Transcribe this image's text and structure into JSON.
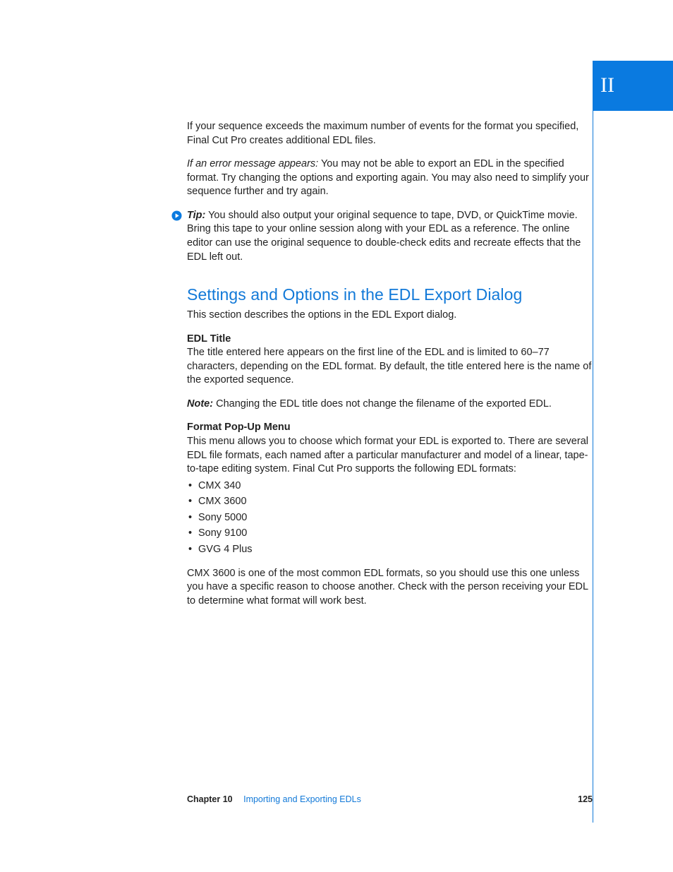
{
  "partTab": "II",
  "body": {
    "p1": "If your sequence exceeds the maximum number of events for the format you specified, Final Cut Pro creates additional EDL files.",
    "p2_lead": "If an error message appears:",
    "p2_rest": "  You may not be able to export an EDL in the specified format. Try changing the options and exporting again. You may also need to simplify your sequence further and try again.",
    "tip_label": "Tip:",
    "tip_rest": "  You should also output your original sequence to tape, DVD, or QuickTime movie. Bring this tape to your online session along with your EDL as a reference. The online editor can use the original sequence to double-check edits and recreate effects that the EDL left out.",
    "heading": "Settings and Options in the EDL Export Dialog",
    "intro": "This section describes the options in the EDL Export dialog.",
    "sub1_title": "EDL Title",
    "sub1_body": "The title entered here appears on the first line of the EDL and is limited to 60–77 characters, depending on the EDL format. By default, the title entered here is the name of the exported sequence.",
    "note_label": "Note:",
    "note_rest": "  Changing the EDL title does not change the filename of the exported EDL.",
    "sub2_title": "Format Pop-Up Menu",
    "sub2_body": "This menu allows you to choose which format your EDL is exported to. There are several EDL file formats, each named after a particular manufacturer and model of a linear, tape-to-tape editing system. Final Cut Pro supports the following EDL formats:",
    "formats": [
      "CMX 340",
      "CMX 3600",
      "Sony 5000",
      "Sony 9100",
      "GVG 4 Plus"
    ],
    "closing": "CMX 3600 is one of the most common EDL formats, so you should use this one unless you have a specific reason to choose another. Check with the person receiving your EDL to determine what format will work best."
  },
  "footer": {
    "chapterLabel": "Chapter 10",
    "chapterTitle": "Importing and Exporting EDLs",
    "pageNumber": "125"
  }
}
